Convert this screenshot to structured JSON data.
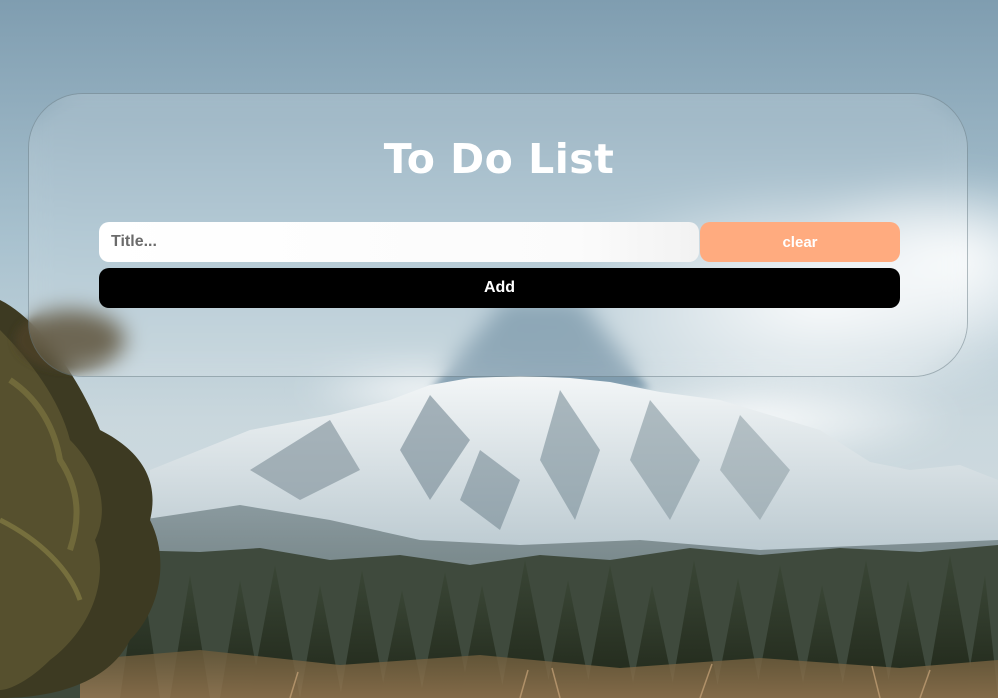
{
  "app": {
    "title": "To Do List"
  },
  "form": {
    "title_placeholder": "Title...",
    "title_value": "",
    "clear_label": "clear",
    "add_label": "Add"
  },
  "colors": {
    "clear_button": "#ffab7f",
    "add_button": "#000000",
    "title_text": "#ffffff"
  }
}
